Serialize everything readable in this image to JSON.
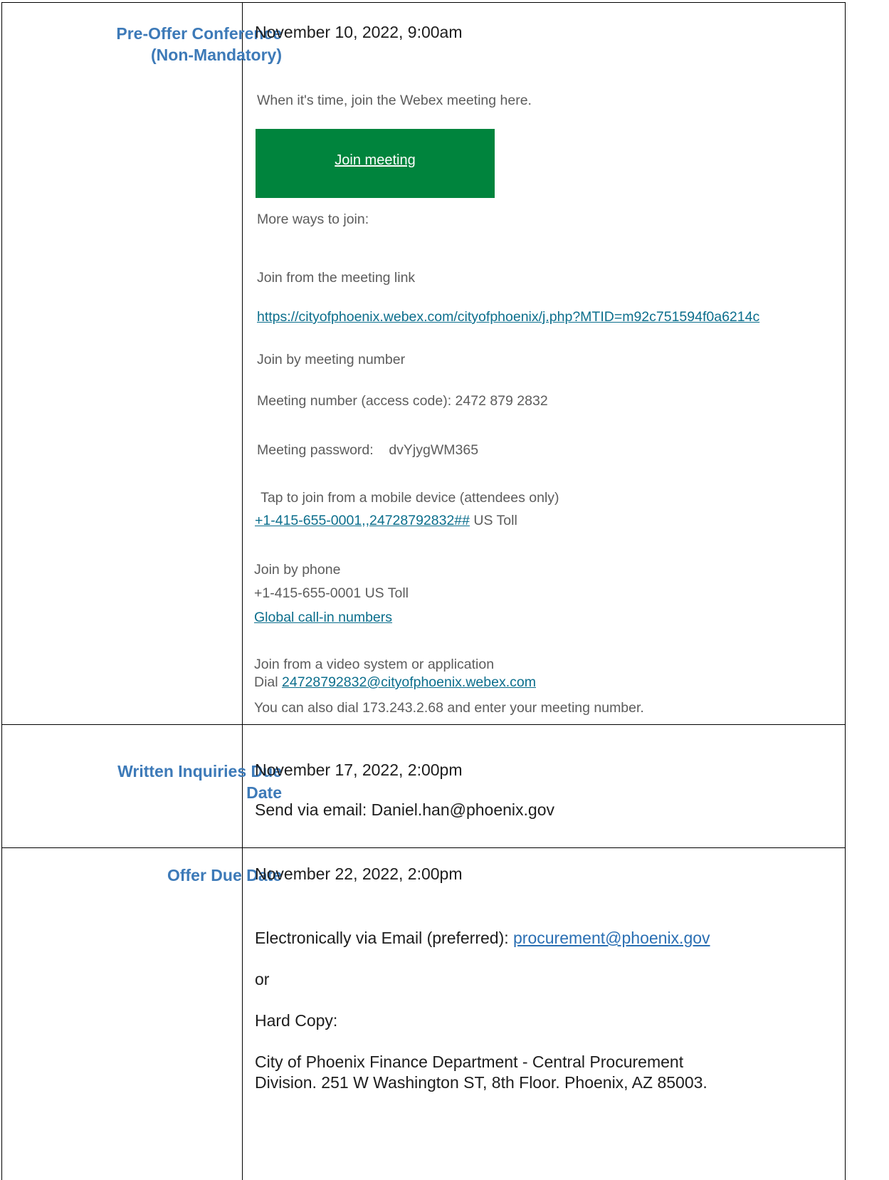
{
  "rows": [
    {
      "label_line1": "Pre-Offer Conference",
      "label_line2": "(Non-Mandatory)",
      "date": "November 10, 2022, 9:00am"
    },
    {
      "label_line1": "Written Inquiries Due",
      "label_line2": "Date",
      "date": "November 17, 2022, 2:00pm",
      "email_line": "Send via email: Daniel.han@phoenix.gov"
    },
    {
      "label": "Offer Due Date",
      "date": "November 22, 2022, 2:00pm",
      "electronic_prefix": "Electronically via Email (preferred): ",
      "electronic_email": "procurement@phoenix.gov",
      "or_text": "or",
      "hard_copy": "Hard Copy:",
      "address_line1": "City of Phoenix Finance Department - Central Procurement",
      "address_line2": "Division. 251 W Washington ST, 8th Floor. Phoenix, AZ 85003."
    }
  ],
  "webex": {
    "intro": "When it's time, join the Webex meeting here.",
    "join_button": "Join meeting",
    "more_ways": "More ways to join:",
    "from_link_heading": "Join from the meeting link",
    "meeting_link": "https://cityofphoenix.webex.com/cityofphoenix/j.php?MTID=m92c751594f0a6214c",
    "by_number_heading": "Join by meeting number",
    "meeting_number": "Meeting number (access code): 2472 879 2832",
    "meeting_password": "Meeting password:    dvYjygWM365",
    "mobile_heading": " Tap to join from a mobile device (attendees only)",
    "mobile_link": "+1-415-655-0001,,24728792832##",
    "mobile_suffix": " US Toll",
    "phone_heading": "Join by phone",
    "phone_number": "+1-415-655-0001 US Toll",
    "global_link": "Global call-in numbers",
    "video_heading": "Join from a video system or application",
    "dial_prefix": "Dial ",
    "dial_link": "24728792832@cityofphoenix.webex.com",
    "dial_note": "You can also dial 173.243.2.68 and enter your meeting number."
  }
}
